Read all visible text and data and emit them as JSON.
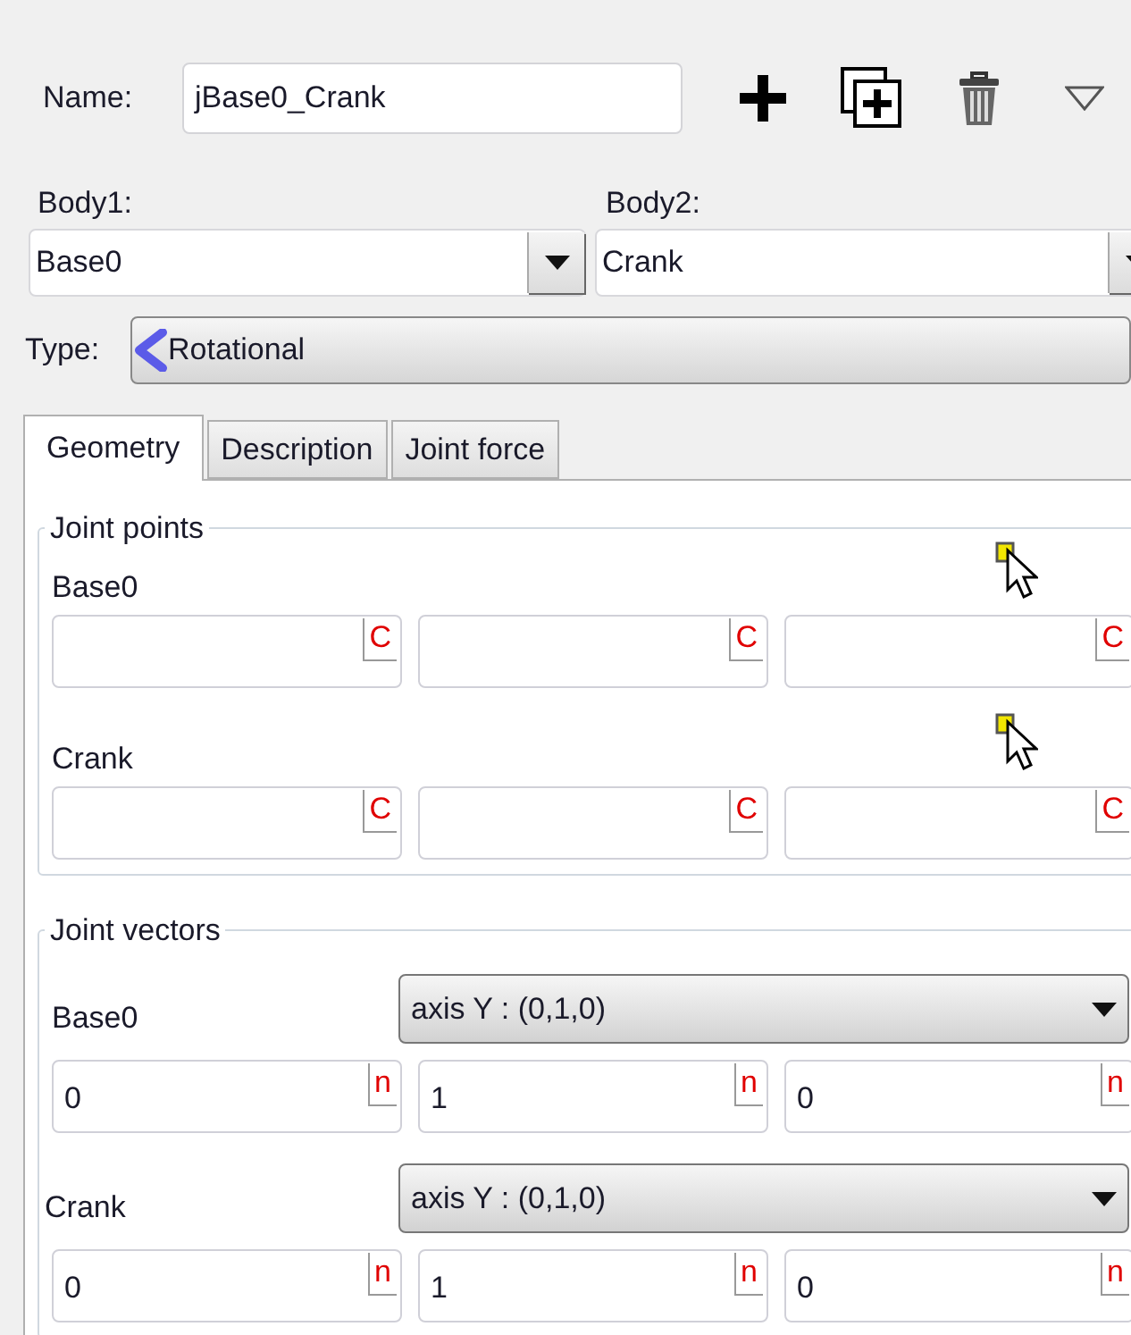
{
  "name_field": {
    "label": "Name:",
    "value": "jBase0_Crank"
  },
  "toolbar": [
    {
      "kind": "add"
    },
    {
      "kind": "duplicate"
    },
    {
      "kind": "delete"
    },
    {
      "kind": "menu"
    }
  ],
  "body1": {
    "label": "Body1:",
    "value": "Base0"
  },
  "body2": {
    "label": "Body2:",
    "value": "Crank"
  },
  "type": {
    "label": "Type:",
    "value": "Rotational"
  },
  "tabs": [
    {
      "label": "Geometry",
      "selected": true
    },
    {
      "label": "Description",
      "selected": false
    },
    {
      "label": "Joint force",
      "selected": false
    }
  ],
  "joint_points": {
    "title": "Joint points",
    "rows": [
      {
        "label": "Base0",
        "fields": [
          {
            "badge": "C"
          },
          {
            "badge": "C"
          },
          {
            "badge": "C"
          }
        ]
      },
      {
        "label": "Crank",
        "fields": [
          {
            "badge": "C"
          },
          {
            "badge": "C"
          },
          {
            "badge": "C"
          }
        ]
      }
    ]
  },
  "joint_vectors": {
    "title": "Joint vectors",
    "rows": [
      {
        "label": "Base0",
        "axis": "axis Y : (0,1,0)",
        "fields": [
          {
            "value": "0",
            "badge": "n"
          },
          {
            "value": "1",
            "badge": "n"
          },
          {
            "value": "0",
            "badge": "n"
          }
        ]
      },
      {
        "label": "Crank",
        "axis": "axis Y : (0,1,0)",
        "fields": [
          {
            "value": "0",
            "badge": "n"
          },
          {
            "value": "1",
            "badge": "n"
          },
          {
            "value": "0",
            "badge": "n"
          }
        ]
      }
    ]
  }
}
